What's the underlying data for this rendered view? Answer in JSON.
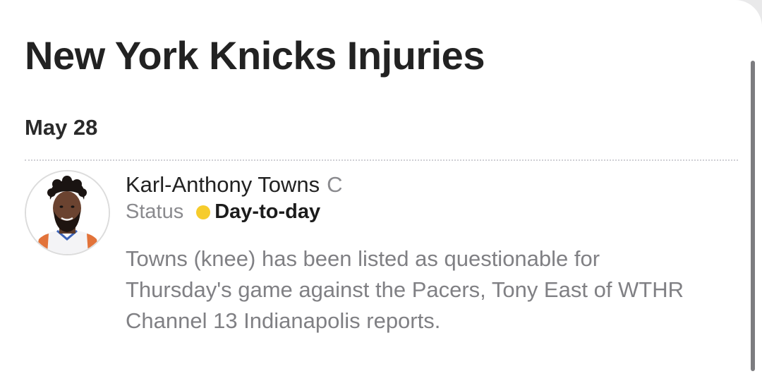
{
  "page": {
    "title": "New York Knicks Injuries"
  },
  "injury_list": {
    "groups": [
      {
        "date": "May 28",
        "entries": [
          {
            "player_name": "Karl-Anthony Towns",
            "position": "C",
            "status_label": "Status",
            "status_value": "Day-to-day",
            "status_color": "#f6cc2c",
            "avatar_icon": "player-headshot",
            "note": "Towns (knee) has been listed as questionable for Thursday's game against the Pacers, Tony East of WTHR Channel 13 Indianapolis reports."
          }
        ]
      }
    ]
  },
  "colors": {
    "title_text": "#222222",
    "secondary_text": "#8a8a8e",
    "divider": "#cfcfd4",
    "status_day_to_day": "#f6cc2c"
  }
}
